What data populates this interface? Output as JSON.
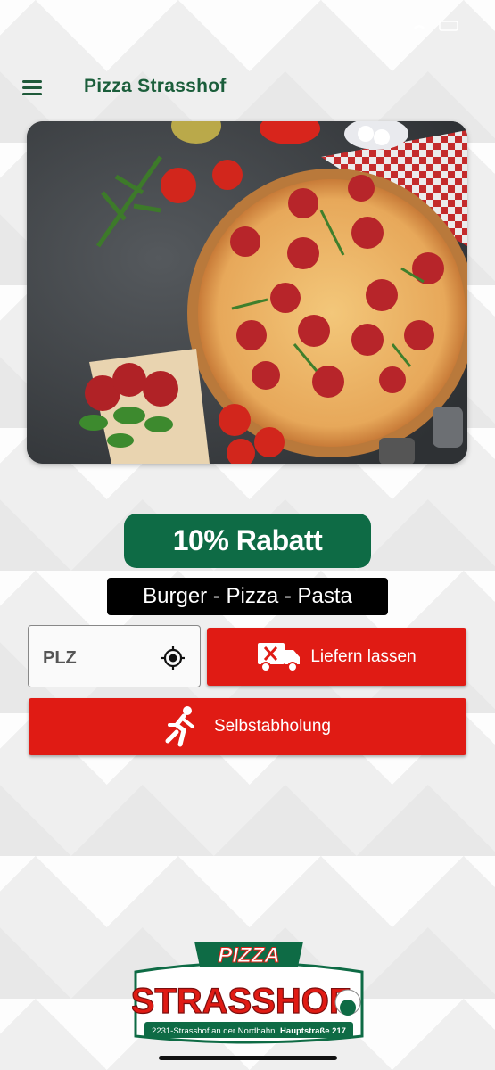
{
  "header": {
    "title": "Pizza Strasshof",
    "menu_icon": "hamburger-menu-icon"
  },
  "hero": {
    "description_icon": "pizza-photo"
  },
  "promo": {
    "discount": "10% Rabatt",
    "tagline": "Burger - Pizza - Pasta"
  },
  "delivery": {
    "zip_placeholder": "PLZ",
    "zip_value": "",
    "locate_icon": "crosshair-location-icon",
    "deliver_label": "Liefern lassen",
    "deliver_icon": "delivery-truck-icon",
    "pickup_label": "Selbstabholung",
    "pickup_icon": "running-person-icon"
  },
  "logo": {
    "top": "PIZZA",
    "main": "STRASSHOF",
    "address_plain": "2231-Strasshof an der Nordbahn",
    "address_bold": "Hauptstraße 217"
  },
  "colors": {
    "brand_green": "#0e6b45",
    "action_red": "#e01b14",
    "title_green": "#1b5e3b"
  }
}
